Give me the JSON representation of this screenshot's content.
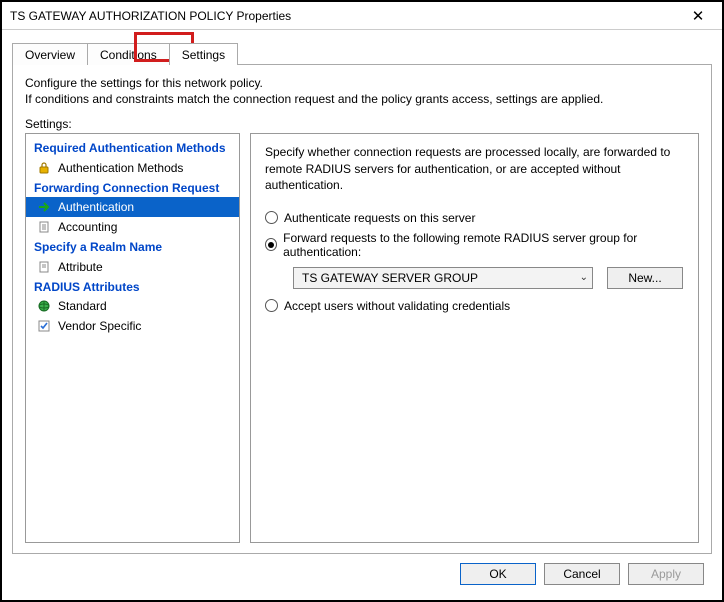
{
  "window": {
    "title": "TS GATEWAY AUTHORIZATION POLICY Properties"
  },
  "tabs": {
    "overview": "Overview",
    "conditions": "Conditions",
    "settings": "Settings"
  },
  "intro": {
    "line1": "Configure the settings for this network policy.",
    "line2": "If conditions and constraints match the connection request and the policy grants access, settings are applied."
  },
  "settings_label": "Settings:",
  "tree": {
    "cat_auth": "Required Authentication Methods",
    "auth_methods": "Authentication Methods",
    "cat_fwd": "Forwarding Connection Request",
    "authentication": "Authentication",
    "accounting": "Accounting",
    "cat_realm": "Specify a Realm Name",
    "attribute": "Attribute",
    "cat_radius": "RADIUS Attributes",
    "standard": "Standard",
    "vendor": "Vendor Specific"
  },
  "panel": {
    "desc": "Specify whether connection requests are processed locally, are forwarded to remote RADIUS servers for authentication, or are accepted without authentication.",
    "opt_local": "Authenticate requests on this server",
    "opt_forward": "Forward requests to the following remote RADIUS server group for authentication:",
    "opt_accept": "Accept users without validating credentials",
    "group_selected": "TS GATEWAY SERVER GROUP",
    "new_btn": "New..."
  },
  "buttons": {
    "ok": "OK",
    "cancel": "Cancel",
    "apply": "Apply"
  }
}
